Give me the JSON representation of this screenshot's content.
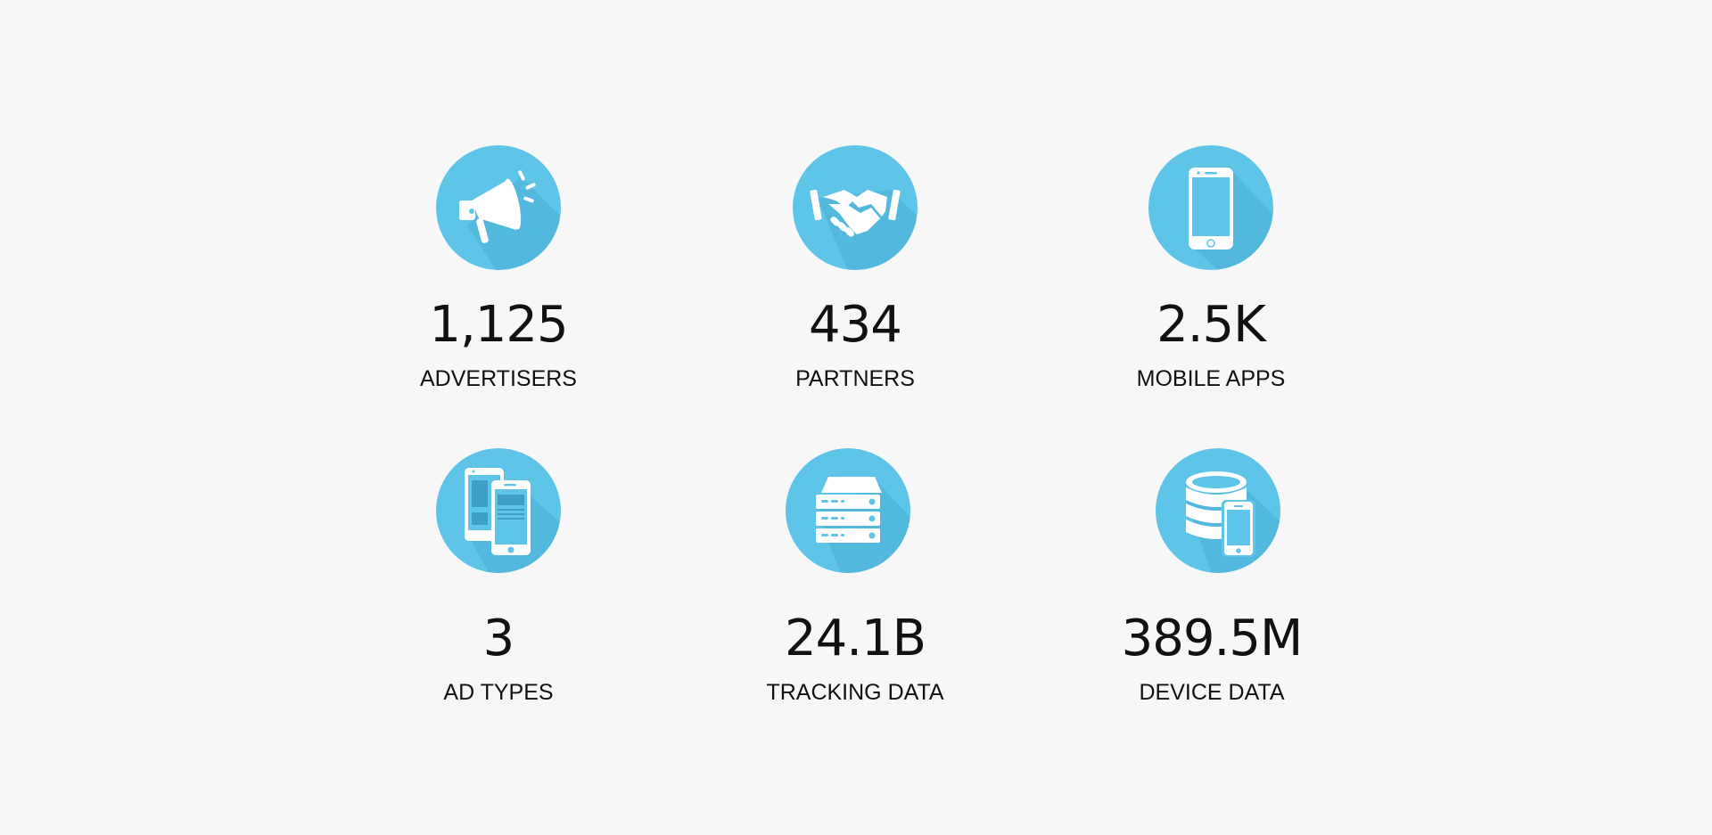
{
  "stats": [
    {
      "value": "1,125",
      "label": "ADVERTISERS",
      "icon": "megaphone-icon"
    },
    {
      "value": "434",
      "label": "PARTNERS",
      "icon": "handshake-icon"
    },
    {
      "value": "2.5K",
      "label": "MOBILE APPS",
      "icon": "smartphone-icon"
    },
    {
      "value": "3",
      "label": "AD TYPES",
      "icon": "ad-screens-icon"
    },
    {
      "value": "24.1B",
      "label": "TRACKING DATA",
      "icon": "server-stack-icon"
    },
    {
      "value": "389.5M",
      "label": "DEVICE DATA",
      "icon": "database-device-icon"
    }
  ],
  "colors": {
    "background": "#f7f7f7",
    "badge": "#5ec5e9",
    "badge_shadow": "#4fb3d9",
    "icon": "#ffffff",
    "text": "#111111"
  }
}
